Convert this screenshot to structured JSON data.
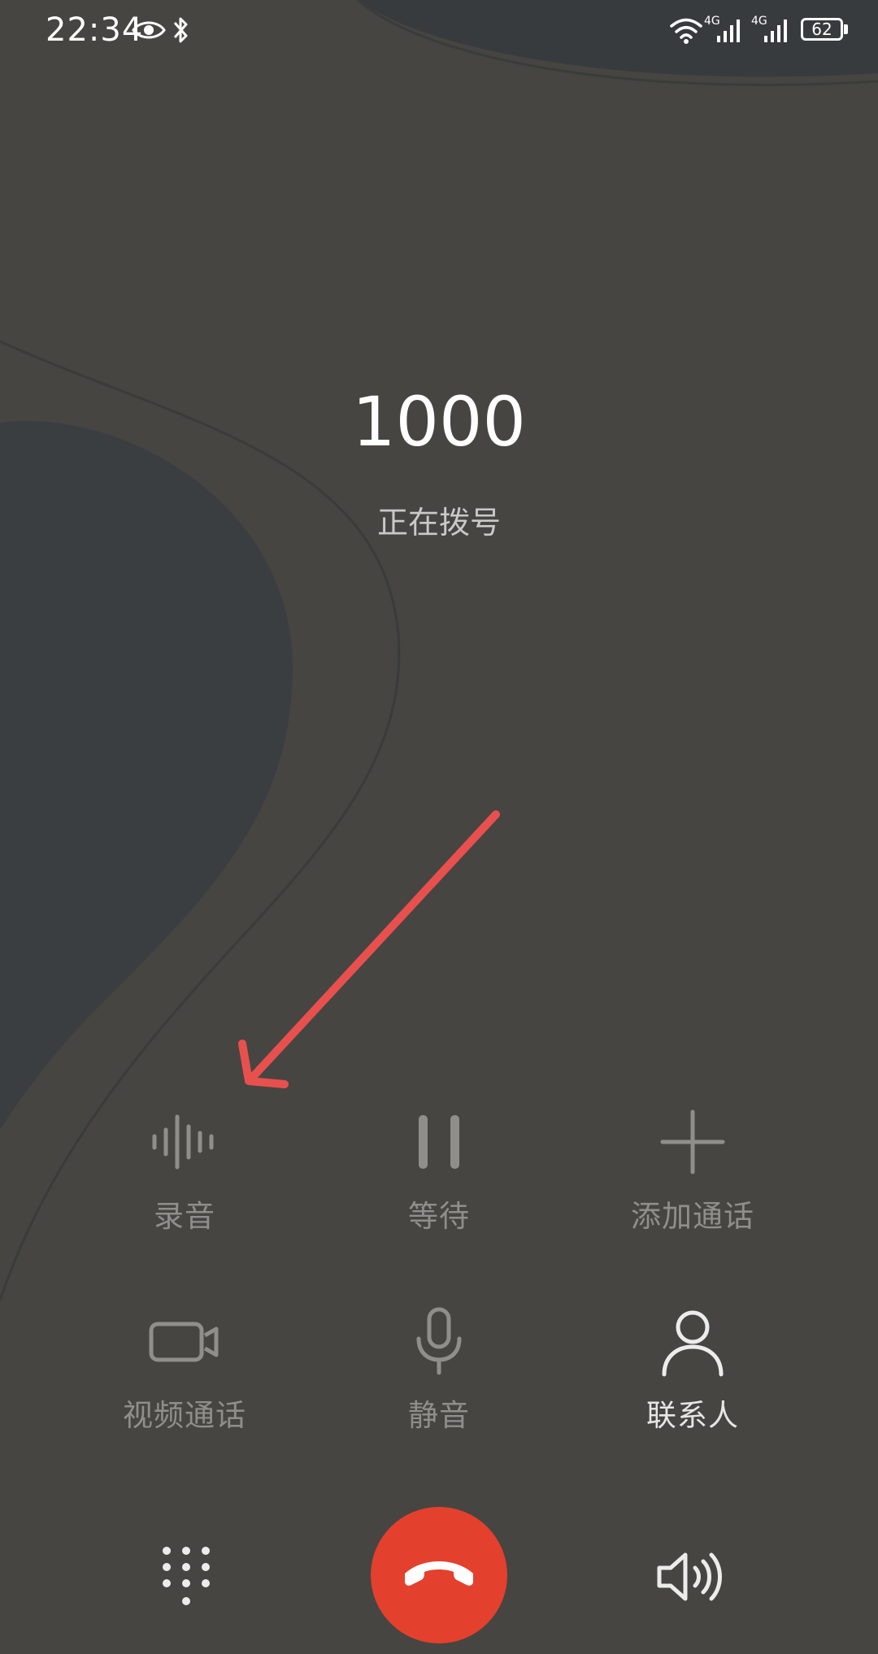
{
  "status_bar": {
    "time": "22:34",
    "icons": [
      "eye-icon",
      "bluetooth-icon",
      "wifi-icon",
      "signal-4g-icon",
      "signal-4g-icon"
    ],
    "network_labels": [
      "4G",
      "4G"
    ],
    "battery_level": "62"
  },
  "call": {
    "number": "1000",
    "status": "正在拨号"
  },
  "controls": {
    "record": "录音",
    "hold": "等待",
    "add_call": "添加通话",
    "video_call": "视频通话",
    "mute": "静音",
    "contacts": "联系人"
  },
  "bottom": {
    "dialpad_icon": "dialpad-icon",
    "end_call_icon": "end-call-icon",
    "speaker_icon": "speaker-icon"
  },
  "colors": {
    "background": "#464542",
    "end_call": "#e4402e",
    "annotation_arrow": "#e8504e",
    "disabled_label": "#8f8e8b",
    "enabled_label": "#e6e6e4"
  }
}
